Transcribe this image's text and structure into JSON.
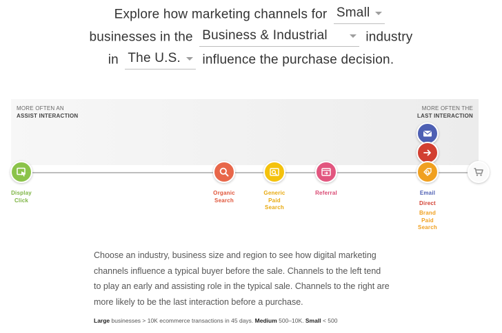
{
  "headline": {
    "line1_prefix": "Explore how marketing channels for",
    "size_value": "Small",
    "line2_prefix": "businesses in the",
    "industry_value": "Business & Industrial",
    "line2_suffix": "industry",
    "line3_prefix": "in",
    "region_value": "The U.S.",
    "line3_suffix": "influence the purchase decision."
  },
  "band": {
    "left_line1": "MORE OFTEN AN",
    "left_line2": "ASSIST INTERACTION",
    "right_line1": "MORE OFTEN THE",
    "right_line2": "LAST INTERACTION"
  },
  "channels": {
    "display": {
      "line1": "Display",
      "line2": "Click",
      "color": "#8bc34a",
      "icon": "display-click-icon"
    },
    "organic": {
      "line1": "Organic",
      "line2": "Search",
      "color": "#e8674a",
      "icon": "magnifier-icon"
    },
    "generic": {
      "line1": "Generic",
      "line2": "Paid",
      "line3": "Search",
      "color": "#f4c20d",
      "icon": "paid-search-icon"
    },
    "referral": {
      "line1": "Referral",
      "color": "#e2567f",
      "icon": "referral-window-icon"
    },
    "email": {
      "line1": "Email",
      "color": "#4d5fb3",
      "icon": "envelope-icon"
    },
    "direct": {
      "line1": "Direct",
      "color": "#d23f31",
      "icon": "arrow-right-icon"
    },
    "brand": {
      "line1": "Brand",
      "line2": "Paid",
      "line3": "Search",
      "color": "#f0a020",
      "icon": "brand-search-icon"
    }
  },
  "cart": {
    "icon": "shopping-cart-icon"
  },
  "description": {
    "line1": "Choose an industry, business size and region to see how digital marketing",
    "line2": "channels influence a typical buyer before the sale. Channels to the left tend",
    "line3": "to play an early and assisting role in the typical sale. Channels to the right are",
    "line4": "more likely to be the last interaction before a purchase."
  },
  "legend": {
    "large_label": "Large",
    "large_text": " businesses > 10K ecommerce transactions in 45 days. ",
    "medium_label": "Medium",
    "medium_text": " 500–10K. ",
    "small_label": "Small",
    "small_text": " < 500"
  }
}
